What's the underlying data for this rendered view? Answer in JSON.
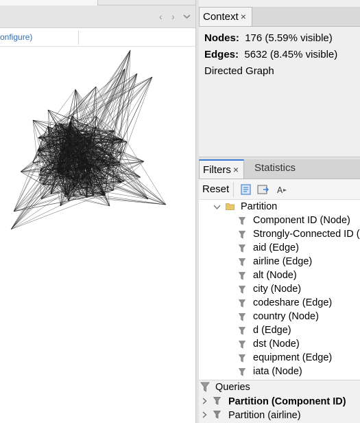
{
  "graph_view": {
    "configure_link": "onfigure)",
    "nav_prev": "‹",
    "nav_next": "›",
    "nav_menu": "⌄"
  },
  "context": {
    "tab_label": "Context",
    "tab_close": "×",
    "nodes_label": "Nodes:",
    "nodes_value": "176 (5.59% visible)",
    "edges_label": "Edges:",
    "edges_value": "5632 (8.45% visible)",
    "graph_type": "Directed Graph"
  },
  "filters": {
    "tabs": [
      {
        "label": "Filters",
        "close": "×"
      },
      {
        "label": "Statistics"
      }
    ],
    "toolbar": {
      "reset_label": "Reset"
    },
    "tree": {
      "root_label": "Partition",
      "items": [
        "Component ID (Node)",
        "Strongly-Connected ID (",
        "aid (Edge)",
        "airline (Edge)",
        "alt (Node)",
        "city (Node)",
        "codeshare (Edge)",
        "country (Node)",
        "d (Edge)",
        "dst (Node)",
        "equipment (Edge)",
        "iata (Node)"
      ]
    },
    "queries": {
      "label": "Queries",
      "items": [
        {
          "label": "Partition (Component ID)",
          "bold": true
        },
        {
          "label": "Partition (airline)",
          "bold": false
        }
      ]
    }
  },
  "colors": {
    "accent": "#3b7bd6",
    "link": "#2b6fb7",
    "folder": "#e8c66a"
  }
}
